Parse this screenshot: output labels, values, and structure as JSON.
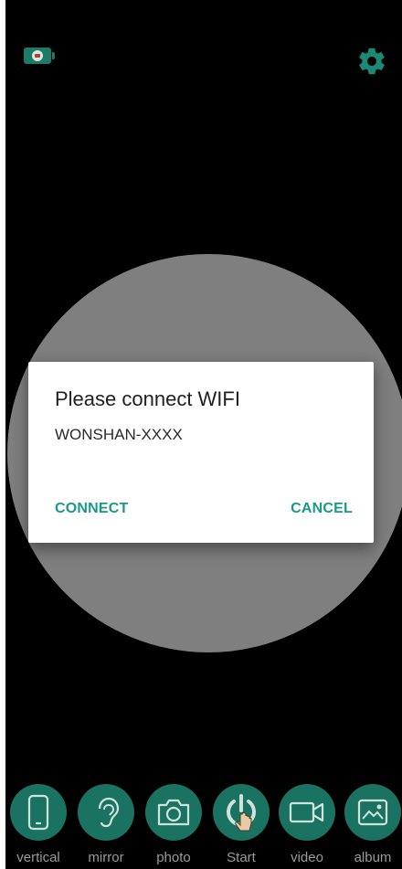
{
  "dialog": {
    "title": "Please connect WIFI",
    "message": "WONSHAN-XXXX",
    "connect_label": "CONNECT",
    "cancel_label": "CANCEL"
  },
  "toolbar": {
    "items": [
      {
        "label": "vertical",
        "icon": "phone-icon"
      },
      {
        "label": "mirror",
        "icon": "ear-icon"
      },
      {
        "label": "photo",
        "icon": "camera-icon"
      },
      {
        "label": "Start",
        "icon": "power-icon"
      },
      {
        "label": "video",
        "icon": "video-camera-icon"
      },
      {
        "label": "album",
        "icon": "image-icon"
      }
    ]
  },
  "colors": {
    "accent": "#1a9a86",
    "toolbar_button": "#1a7361",
    "background": "#000000",
    "preview": "#7f7f7f"
  }
}
